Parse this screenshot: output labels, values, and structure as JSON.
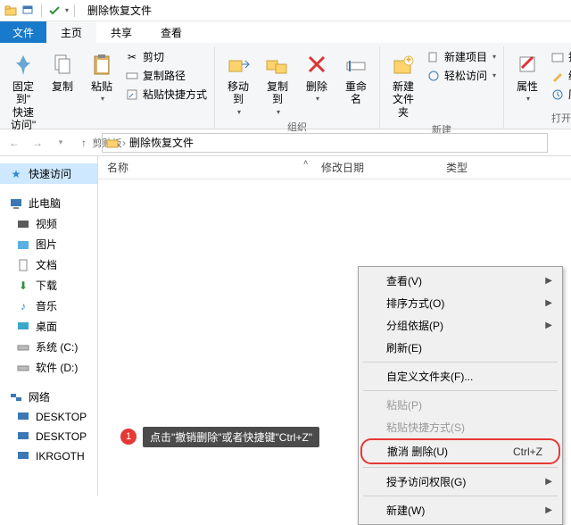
{
  "titlebar": {
    "title": "删除恢复文件"
  },
  "menu": {
    "file": "文件",
    "home": "主页",
    "share": "共享",
    "view": "查看"
  },
  "ribbon": {
    "clipboard": {
      "label": "剪贴板",
      "pin": "固定到\"\n快速访问\"",
      "copy": "复制",
      "paste": "粘贴",
      "cut": "剪切",
      "copypath": "复制路径",
      "pasteshortcut": "粘贴快捷方式"
    },
    "organize": {
      "label": "组织",
      "moveto": "移动到",
      "copyto": "复制到",
      "delete": "删除",
      "rename": "重命名"
    },
    "new": {
      "label": "新建",
      "newfolder": "新建\n文件夹",
      "newitem": "新建项目",
      "easyaccess": "轻松访问"
    },
    "open": {
      "label": "打开",
      "properties": "属性",
      "open": "打开",
      "edit": "编辑",
      "history": "历史记录"
    }
  },
  "breadcrumb": {
    "root": "",
    "folder": "删除恢复文件"
  },
  "columns": {
    "name": "名称",
    "date": "修改日期",
    "type": "类型"
  },
  "sidebar": {
    "quick": "快速访问",
    "thispc": "此电脑",
    "videos": "视频",
    "pictures": "图片",
    "documents": "文档",
    "downloads": "下载",
    "music": "音乐",
    "desktop": "桌面",
    "sysc": "系统 (C:)",
    "softd": "软件 (D:)",
    "network": "网络",
    "d1": "DESKTOP",
    "d2": "DESKTOP",
    "d3": "IKRGOTH"
  },
  "context": {
    "view": "查看(V)",
    "sort": "排序方式(O)",
    "group": "分组依据(P)",
    "refresh": "刷新(E)",
    "customize": "自定义文件夹(F)...",
    "paste": "粘贴(P)",
    "pasteshortcut": "粘贴快捷方式(S)",
    "undo": "撤消 删除(U)",
    "undo_shortcut": "Ctrl+Z",
    "grant": "授予访问权限(G)",
    "new": "新建(W)"
  },
  "annotation": {
    "num": "1",
    "tip": "点击\"撤销删除\"或者快捷键\"Ctrl+Z\""
  }
}
